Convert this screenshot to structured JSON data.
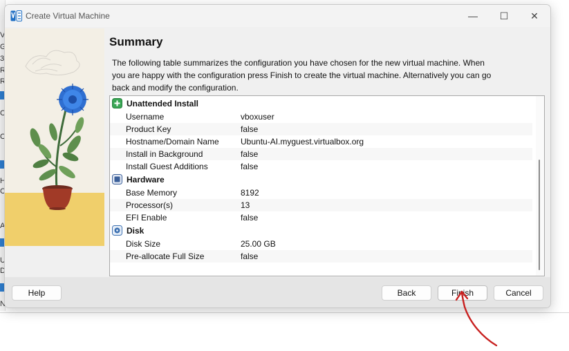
{
  "window": {
    "title": "Create Virtual Machine",
    "minimize_glyph": "—",
    "maximize_glyph": "☐",
    "close_glyph": "✕"
  },
  "summary": {
    "heading": "Summary",
    "description": "The following table summarizes the configuration you have chosen for the new virtual machine. When you are happy with the configuration press Finish to create the virtual machine. Alternatively you can go back and modify the configuration."
  },
  "sections": [
    {
      "title": "Unattended Install",
      "icon": "unattended-install-icon",
      "rows": [
        {
          "key": "Username",
          "value": "vboxuser"
        },
        {
          "key": "Product Key",
          "value": "false"
        },
        {
          "key": "Hostname/Domain Name",
          "value": "Ubuntu-AI.myguest.virtualbox.org"
        },
        {
          "key": "Install in Background",
          "value": "false"
        },
        {
          "key": "Install Guest Additions",
          "value": "false"
        }
      ]
    },
    {
      "title": "Hardware",
      "icon": "hardware-chip-icon",
      "rows": [
        {
          "key": "Base Memory",
          "value": "8192"
        },
        {
          "key": "Processor(s)",
          "value": "13"
        },
        {
          "key": "EFI Enable",
          "value": "false"
        }
      ]
    },
    {
      "title": "Disk",
      "icon": "disk-icon",
      "rows": [
        {
          "key": "Disk Size",
          "value": "25.00 GB"
        },
        {
          "key": "Pre-allocate Full Size",
          "value": "false"
        }
      ]
    }
  ],
  "buttons": {
    "help": "Help",
    "back": "Back",
    "finish": "Finish",
    "cancel": "Cancel"
  },
  "background_app": {
    "left_chars": [
      "V",
      "G",
      "3",
      "R",
      "R",
      "C",
      "C",
      "H",
      "C",
      "A",
      "U",
      "D"
    ],
    "bottom_tag": "None"
  },
  "colors": {
    "accent": "#2f7fd1",
    "section_icon_green": "#3aa655",
    "annotation_red": "#c8201f"
  }
}
